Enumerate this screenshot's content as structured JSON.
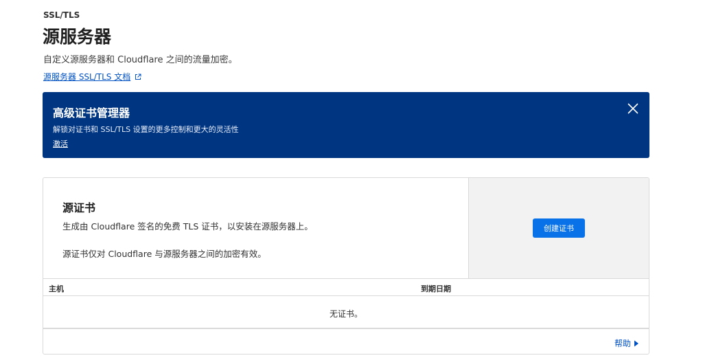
{
  "header": {
    "eyebrow": "SSL/TLS",
    "title": "源服务器",
    "subtitle": "自定义源服务器和 Cloudflare 之间的流量加密。",
    "doc_link": "源服务器 SSL/TLS 文档"
  },
  "banner": {
    "title": "高级证书管理器",
    "description": "解锁对证书和 SSL/TLS 设置的更多控制和更大的灵活性",
    "link": "激活",
    "background": "#003681"
  },
  "origin_card": {
    "title": "源证书",
    "line1": "生成由 Cloudflare 签名的免费 TLS 证书，以安装在源服务器上。",
    "line2": "源证书仅对 Cloudflare 与源服务器之间的加密有效。",
    "create_button": "创建证书",
    "button_color": "#0a72e8"
  },
  "table": {
    "columns": [
      "主机",
      "到期日期"
    ],
    "empty_text": "无证书。"
  },
  "footer": {
    "help_link": "帮助"
  },
  "colors": {
    "link": "#0051c3"
  }
}
